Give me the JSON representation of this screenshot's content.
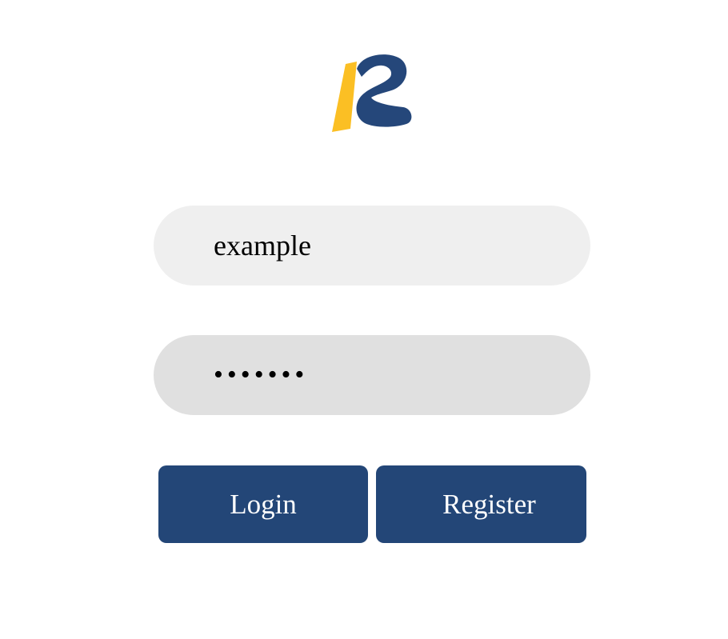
{
  "logo": {
    "icon": "ir-logo-icon",
    "colors": {
      "yellow": "#fbbf24",
      "blue": "#25477a"
    }
  },
  "form": {
    "username_value": "example",
    "password_value": "•••••••"
  },
  "buttons": {
    "login_label": "Login",
    "register_label": "Register"
  },
  "colors": {
    "button_bg": "#234677",
    "username_field_bg": "#efefef",
    "password_field_bg": "#e0e0e0"
  }
}
